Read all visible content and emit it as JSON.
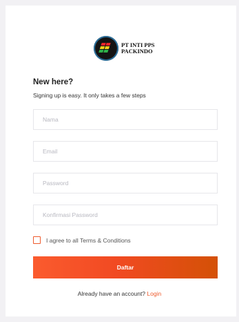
{
  "brand": {
    "logo_icon": "pps-block-logo-icon",
    "name_line1": "PT INTI PPS",
    "name_line2": "PACKINDO"
  },
  "signup": {
    "headline": "New here?",
    "subtext": "Signing up is easy. It only takes a few steps",
    "fields": {
      "name_placeholder": "Nama",
      "email_placeholder": "Email",
      "password_placeholder": "Password",
      "confirm_placeholder": "Konfirmasi Password"
    },
    "terms_label": "I agree to all Terms & Conditions",
    "submit_label": "Daftar",
    "login_prompt": "Already have an account?",
    "login_link": "Login"
  },
  "colors": {
    "accent": "#ee5a2c",
    "button_start": "#fb5b2e",
    "button_end": "#d45106",
    "background": "#f2f1f4"
  }
}
